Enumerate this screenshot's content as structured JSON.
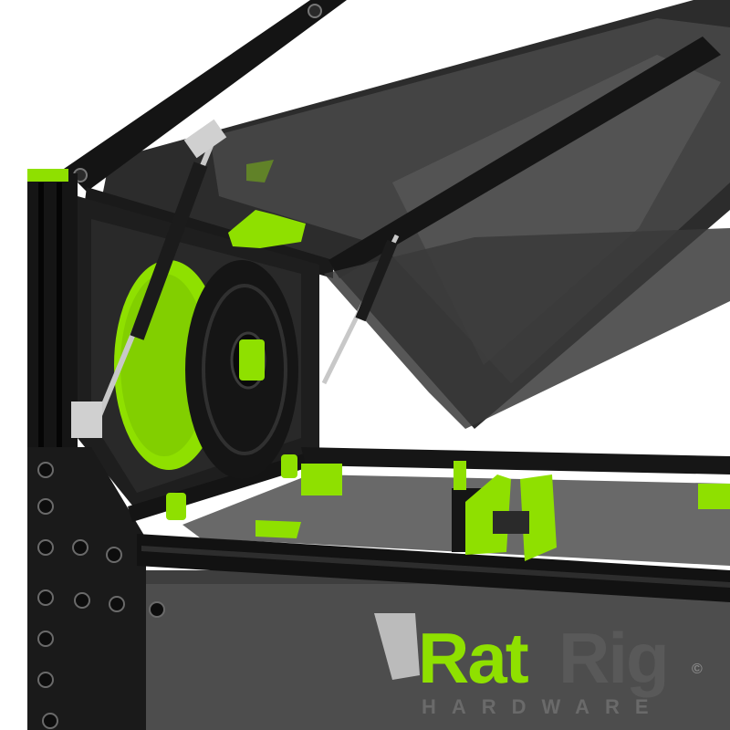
{
  "logo": {
    "brand": "RatRig",
    "brand_part1": "Rat",
    "brand_part2": "Rig",
    "subtitle": "HARDWARE",
    "copyright_symbol": "©"
  },
  "colors": {
    "accent_green": "#8fe000",
    "frame_black": "#111111",
    "panel_smoke": "#4a4a4a",
    "logo_grey": "#5a5a5a",
    "background": "#ffffff"
  },
  "icons": {
    "spool": "filament-spool-icon",
    "gas_strut": "gas-strut-icon",
    "toolhead": "toolhead-icon"
  }
}
